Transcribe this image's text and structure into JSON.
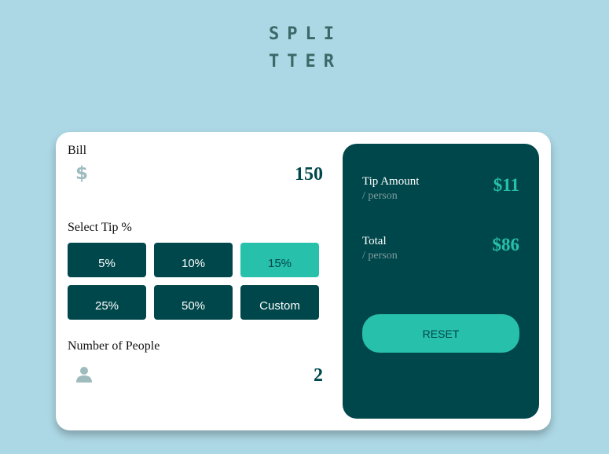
{
  "logo": {
    "line1": "SPLI",
    "line2": "TTER"
  },
  "bill": {
    "label": "Bill",
    "value": "150",
    "icon": "dollar-icon"
  },
  "tip": {
    "label": "Select Tip %",
    "options": [
      "5%",
      "10%",
      "15%",
      "25%",
      "50%",
      "Custom"
    ],
    "selected": "15%"
  },
  "people": {
    "label": "Number of People",
    "value": "2",
    "icon": "person-icon"
  },
  "result": {
    "tip_label": "Tip Amount",
    "tip_sub": "/ person",
    "tip_value": "$11",
    "total_label": "Total",
    "total_sub": "/ person",
    "total_value": "$86",
    "reset_label": "RESET"
  },
  "colors": {
    "background": "#acd7e4",
    "dark_cyan": "#00474b",
    "accent": "#26c0ab",
    "muted": "#9ebbbd"
  }
}
